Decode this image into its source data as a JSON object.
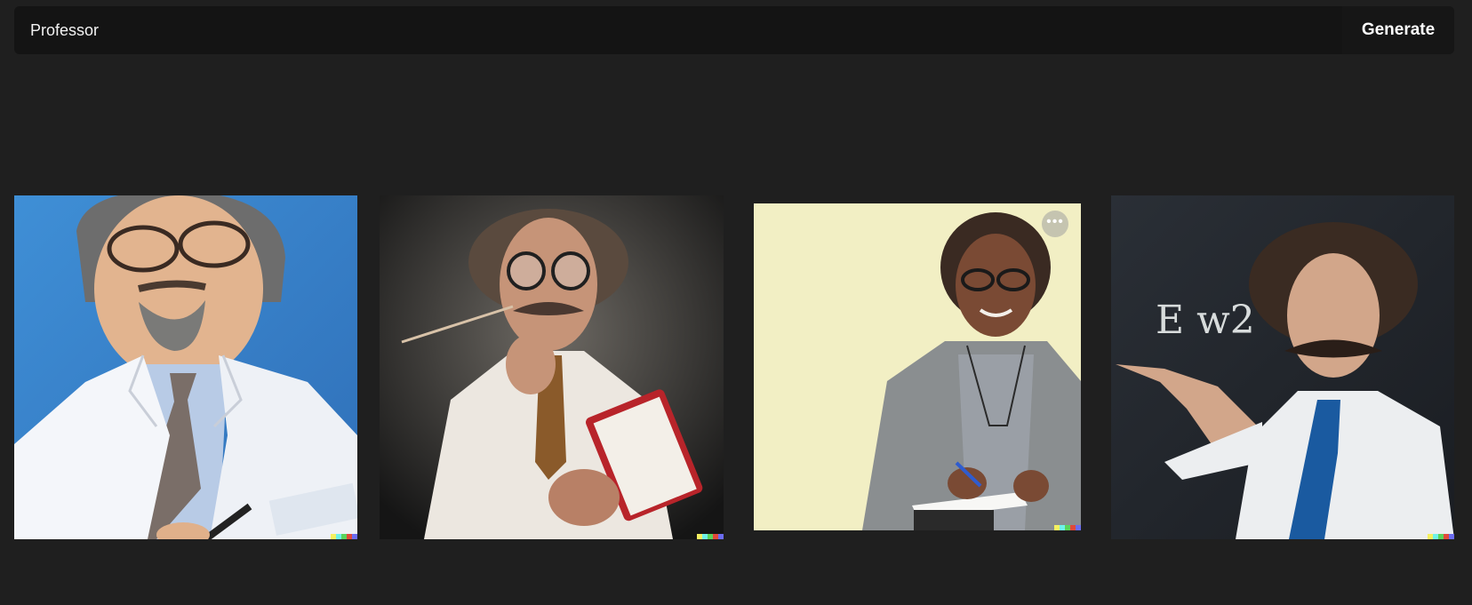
{
  "search": {
    "value": "Professor",
    "generate_label": "Generate"
  },
  "images": [
    {
      "name": "professor-image-1"
    },
    {
      "name": "professor-image-2"
    },
    {
      "name": "professor-image-3",
      "menu_glyph": "•••"
    },
    {
      "name": "professor-image-4",
      "chalk_text": "E w2"
    }
  ],
  "swatch_colors": [
    "#f5f060",
    "#6ff2e8",
    "#5bd35b",
    "#e04a3a",
    "#6b6cf0"
  ],
  "theme": {
    "background": "#1f1f1f",
    "bar": "#141414",
    "text": "#f2f2f2"
  }
}
